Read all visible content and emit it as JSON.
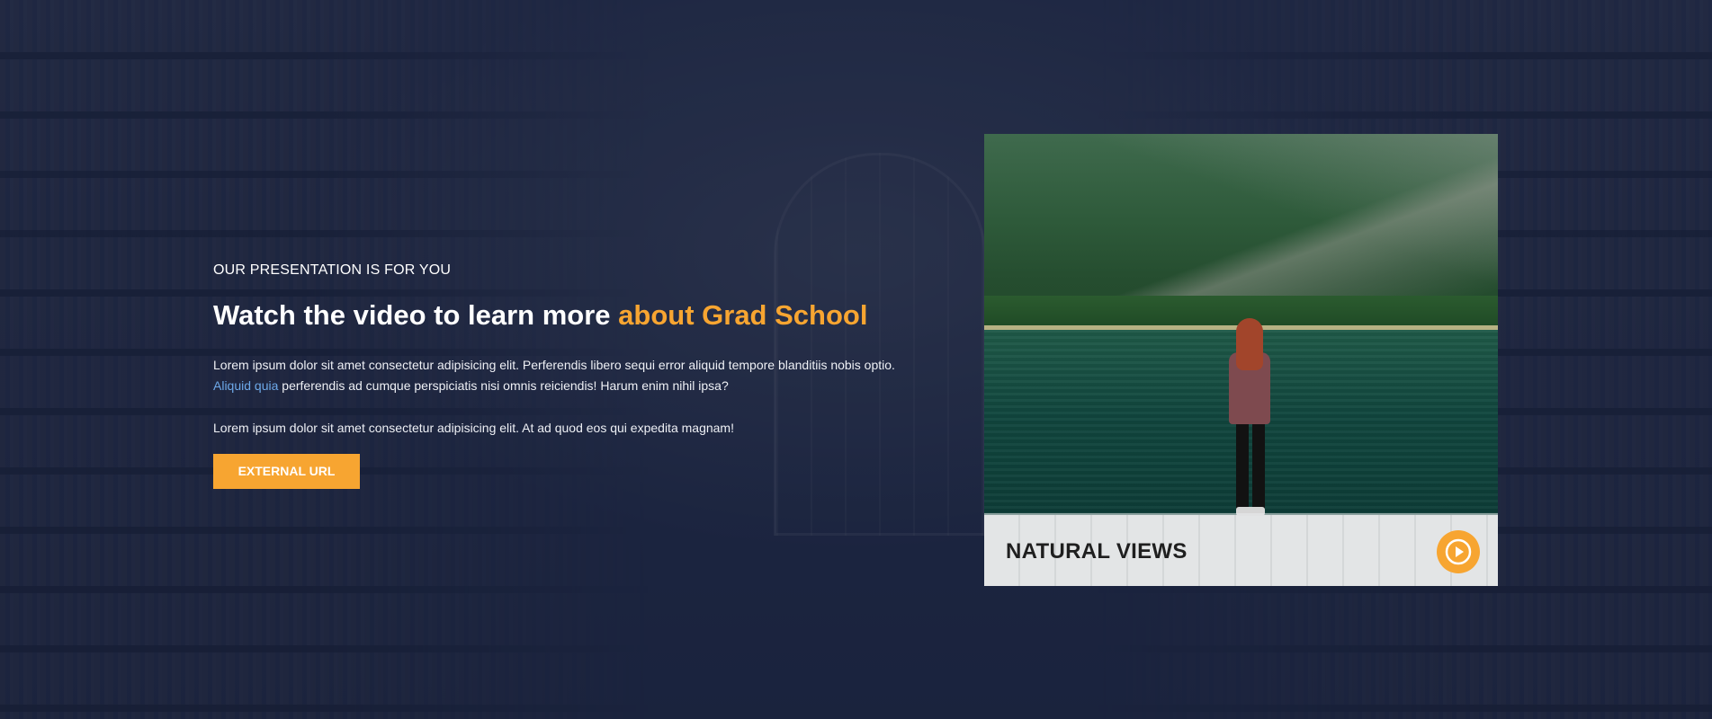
{
  "colors": {
    "background": "#1b2440",
    "accent": "#f7a531",
    "link": "#6da8e8",
    "text": "#ffffff"
  },
  "intro": {
    "eyebrow": "OUR PRESENTATION IS FOR YOU",
    "headline_main": "Watch the video to learn more ",
    "headline_accent": "about Grad School",
    "para1_start": "Lorem ipsum dolor sit amet consectetur adipisicing elit. Perferendis libero sequi error aliquid tempore blanditiis nobis optio. ",
    "para1_link": "Aliquid quia",
    "para1_end": " perferendis ad cumque perspiciatis nisi omnis reiciendis! Harum enim nihil ipsa?",
    "para2": "Lorem ipsum dolor sit amet consectetur adipisicing elit. At ad quod eos qui expedita magnam!",
    "button_label": "External URL"
  },
  "video": {
    "caption": "Natural Views",
    "play_icon": "play-icon"
  }
}
